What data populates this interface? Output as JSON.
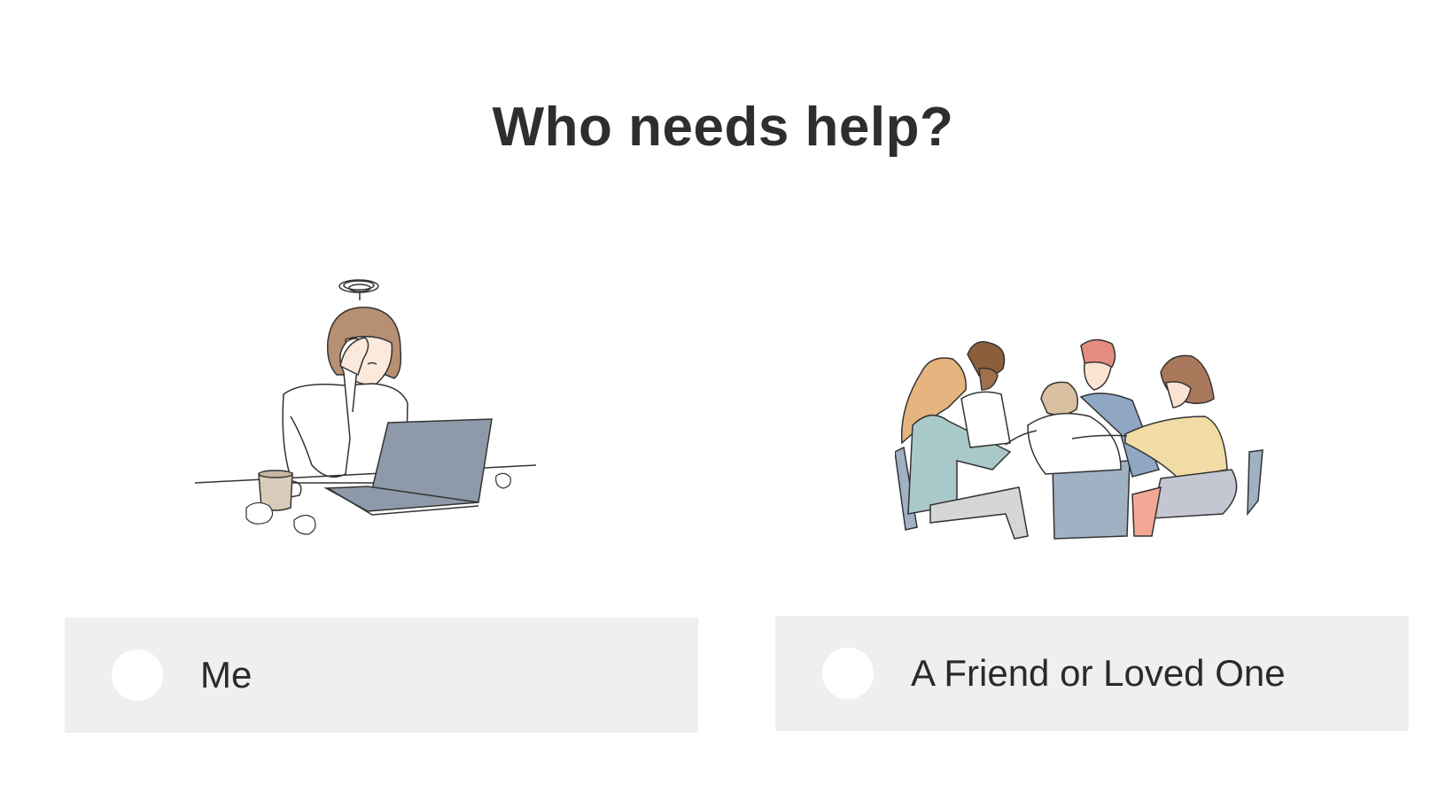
{
  "heading": "Who needs help?",
  "options": [
    {
      "label": "Me",
      "illustration": "stressed-person-at-laptop-illustration",
      "selected": false
    },
    {
      "label": "A Friend or Loved One",
      "illustration": "group-comforting-friend-illustration",
      "selected": false
    }
  ],
  "colors": {
    "background": "#ffffff",
    "option_background": "#efefef",
    "radio_fill": "#ffffff",
    "text": "#2e2e2e"
  }
}
